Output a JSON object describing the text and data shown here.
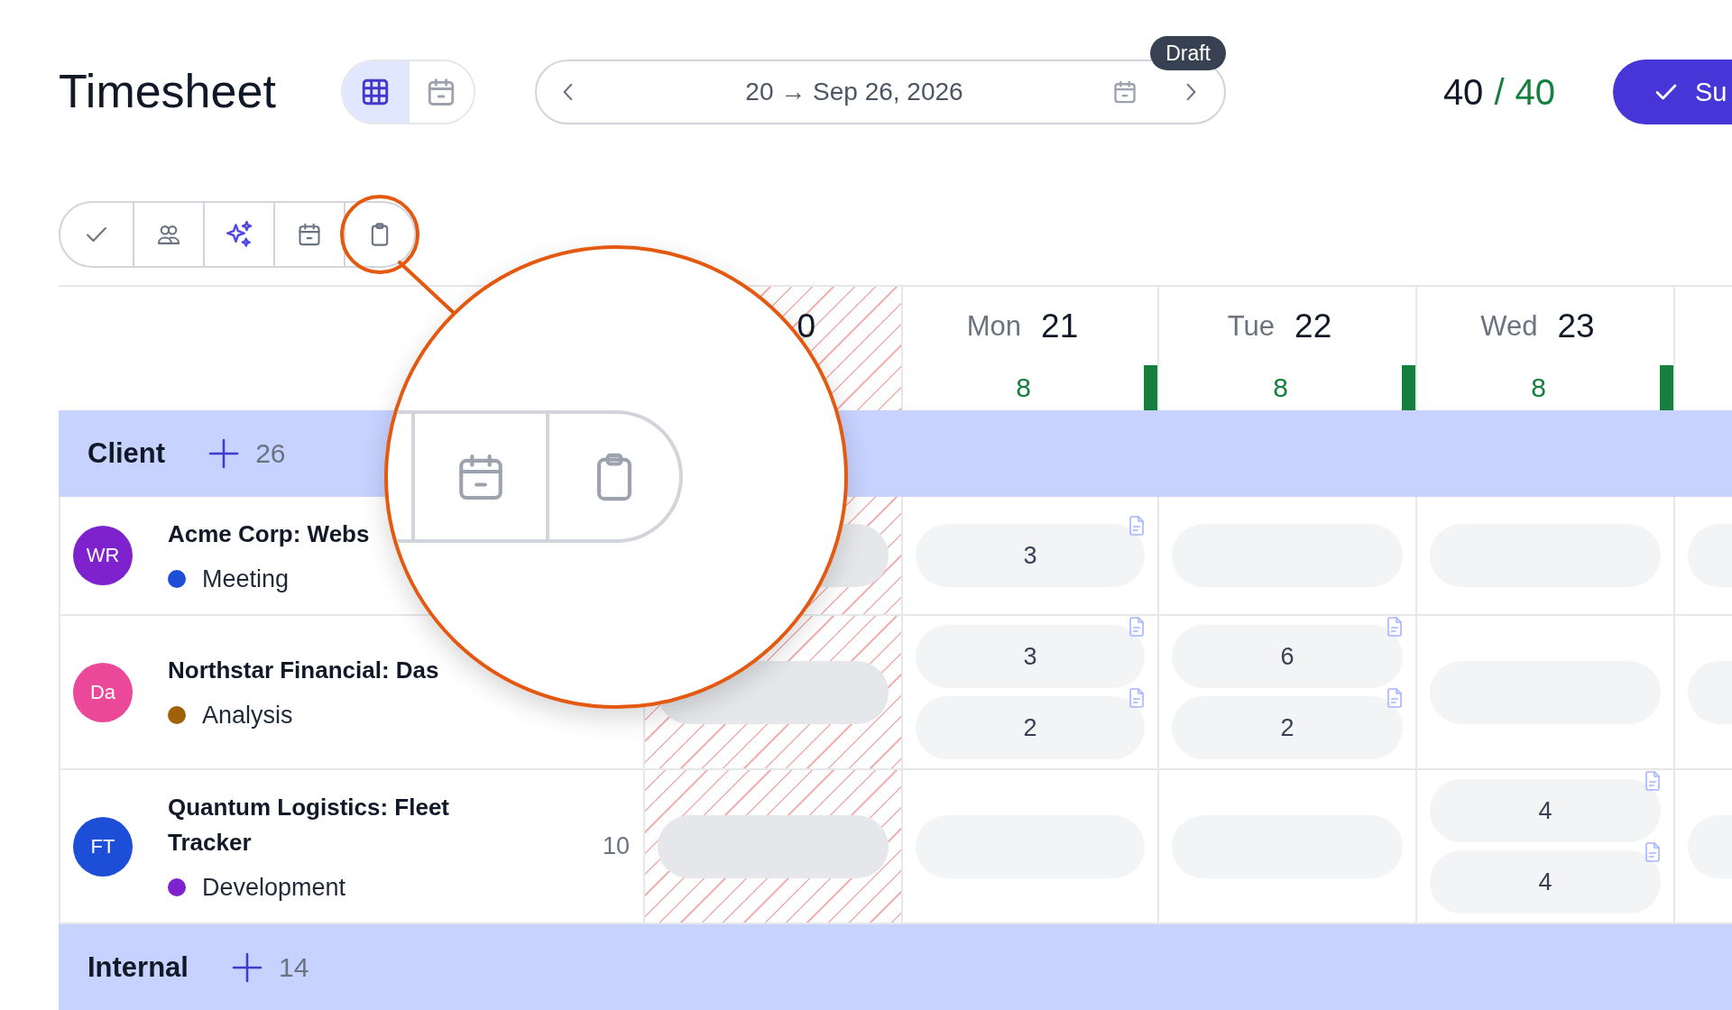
{
  "header": {
    "title": "Timesheet",
    "views": [
      {
        "kind": "grid",
        "selected": true
      },
      {
        "kind": "calendar",
        "selected": false
      }
    ],
    "period": {
      "label": "20 → Sep 26, 2026",
      "status": "Draft"
    },
    "hours": {
      "logged": "40",
      "separator": "/",
      "target": "40",
      "met": true
    },
    "submit": {
      "label": "Su"
    }
  },
  "tools": [
    {
      "kind": "check",
      "highlighted": false
    },
    {
      "kind": "people",
      "highlighted": false
    },
    {
      "kind": "sparkle",
      "highlighted": false
    },
    {
      "kind": "calendar",
      "highlighted": false
    },
    {
      "kind": "clipboard",
      "highlighted": true
    }
  ],
  "grid": {
    "days": [
      {
        "day": "0",
        "weekend": true
      },
      {
        "weekday": "Mon",
        "day": "21",
        "total": "8",
        "level": 1,
        "weekend": false
      },
      {
        "weekday": "Tue",
        "day": "22",
        "total": "8",
        "level": 1,
        "weekend": false
      },
      {
        "weekday": "Wed",
        "day": "23",
        "total": "8",
        "level": 1,
        "weekend": false
      },
      {
        "weekend": false
      }
    ],
    "groups": [
      {
        "name": "Client",
        "count": "26",
        "rows": [
          {
            "avatar": {
              "initials": "WR",
              "color": "#7e22ce"
            },
            "title": "Acme Corp: Webs",
            "activity": {
              "label": "Meeting",
              "color": "#1d4ed8"
            },
            "cells": [
              [
                {
                  "note": false
                }
              ],
              [
                {
                  "value": "3",
                  "note": true
                }
              ],
              [
                {
                  "note": false
                }
              ],
              [
                {
                  "note": false
                }
              ],
              [
                {
                  "note": false
                }
              ]
            ]
          },
          {
            "avatar": {
              "initials": "Da",
              "color": "#ec4899"
            },
            "title": "Northstar Financial: Das",
            "activity": {
              "label": "Analysis",
              "color": "#a16207"
            },
            "cells": [
              [
                {
                  "note": false
                }
              ],
              [
                {
                  "value": "3",
                  "note": true
                },
                {
                  "value": "2",
                  "note": true
                }
              ],
              [
                {
                  "value": "6",
                  "note": true
                },
                {
                  "value": "2",
                  "note": true
                }
              ],
              [
                {
                  "note": false
                }
              ],
              [
                {
                  "note": false
                }
              ]
            ]
          },
          {
            "avatar": {
              "initials": "FT",
              "color": "#1d4ed8"
            },
            "title": "Quantum Logistics: Fleet Tracker",
            "activity": {
              "label": "Development",
              "color": "#7e22ce"
            },
            "total": "10",
            "cells": [
              [
                {
                  "note": false
                }
              ],
              [
                {
                  "note": false
                }
              ],
              [
                {
                  "note": false
                }
              ],
              [
                {
                  "value": "4",
                  "note": true
                },
                {
                  "value": "4",
                  "note": true
                }
              ],
              [
                {
                  "note": false
                }
              ]
            ]
          }
        ]
      },
      {
        "name": "Internal",
        "count": "14"
      }
    ]
  }
}
